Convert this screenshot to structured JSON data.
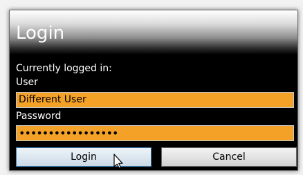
{
  "dialog": {
    "title": "Login",
    "currently_logged_in_label": "Currently logged in:",
    "current_user_label": "User",
    "user_field_value": "Different User",
    "password_label": "Password",
    "password_field_value": "•••••••••••••••••",
    "login_button_label": "Login",
    "cancel_button_label": "Cancel"
  },
  "colors": {
    "field_background": "#f4a127",
    "dialog_background": "#000000"
  },
  "icons": {
    "cursor": "mouse-pointer-icon"
  }
}
